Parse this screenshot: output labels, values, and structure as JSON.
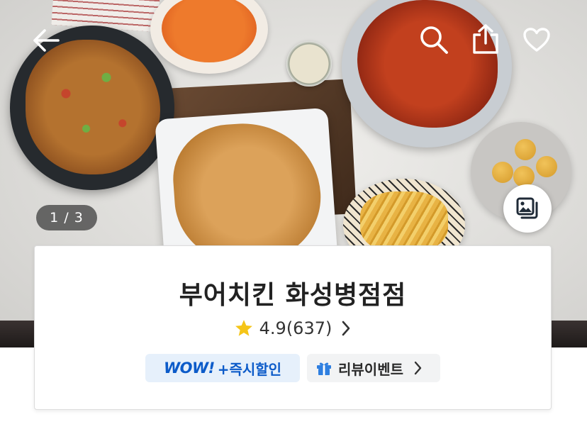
{
  "hero": {
    "image_counter": "1 / 3",
    "icons": {
      "back": "back-arrow-icon",
      "search": "search-icon",
      "share": "share-icon",
      "like": "heart-icon",
      "gallery": "photo-gallery-icon"
    }
  },
  "store": {
    "name": "부어치킨 화성병점점",
    "rating": "4.9",
    "review_count": "(637)"
  },
  "badges": {
    "wow_label": "WOW!",
    "instant_discount_label": "+즉시할인",
    "review_event_label": "리뷰이벤트"
  },
  "colors": {
    "wow_blue": "#0c5bc9",
    "wow_bg": "#e6f0fb",
    "star": "#f5c518",
    "gift": "#2f7fe0"
  }
}
